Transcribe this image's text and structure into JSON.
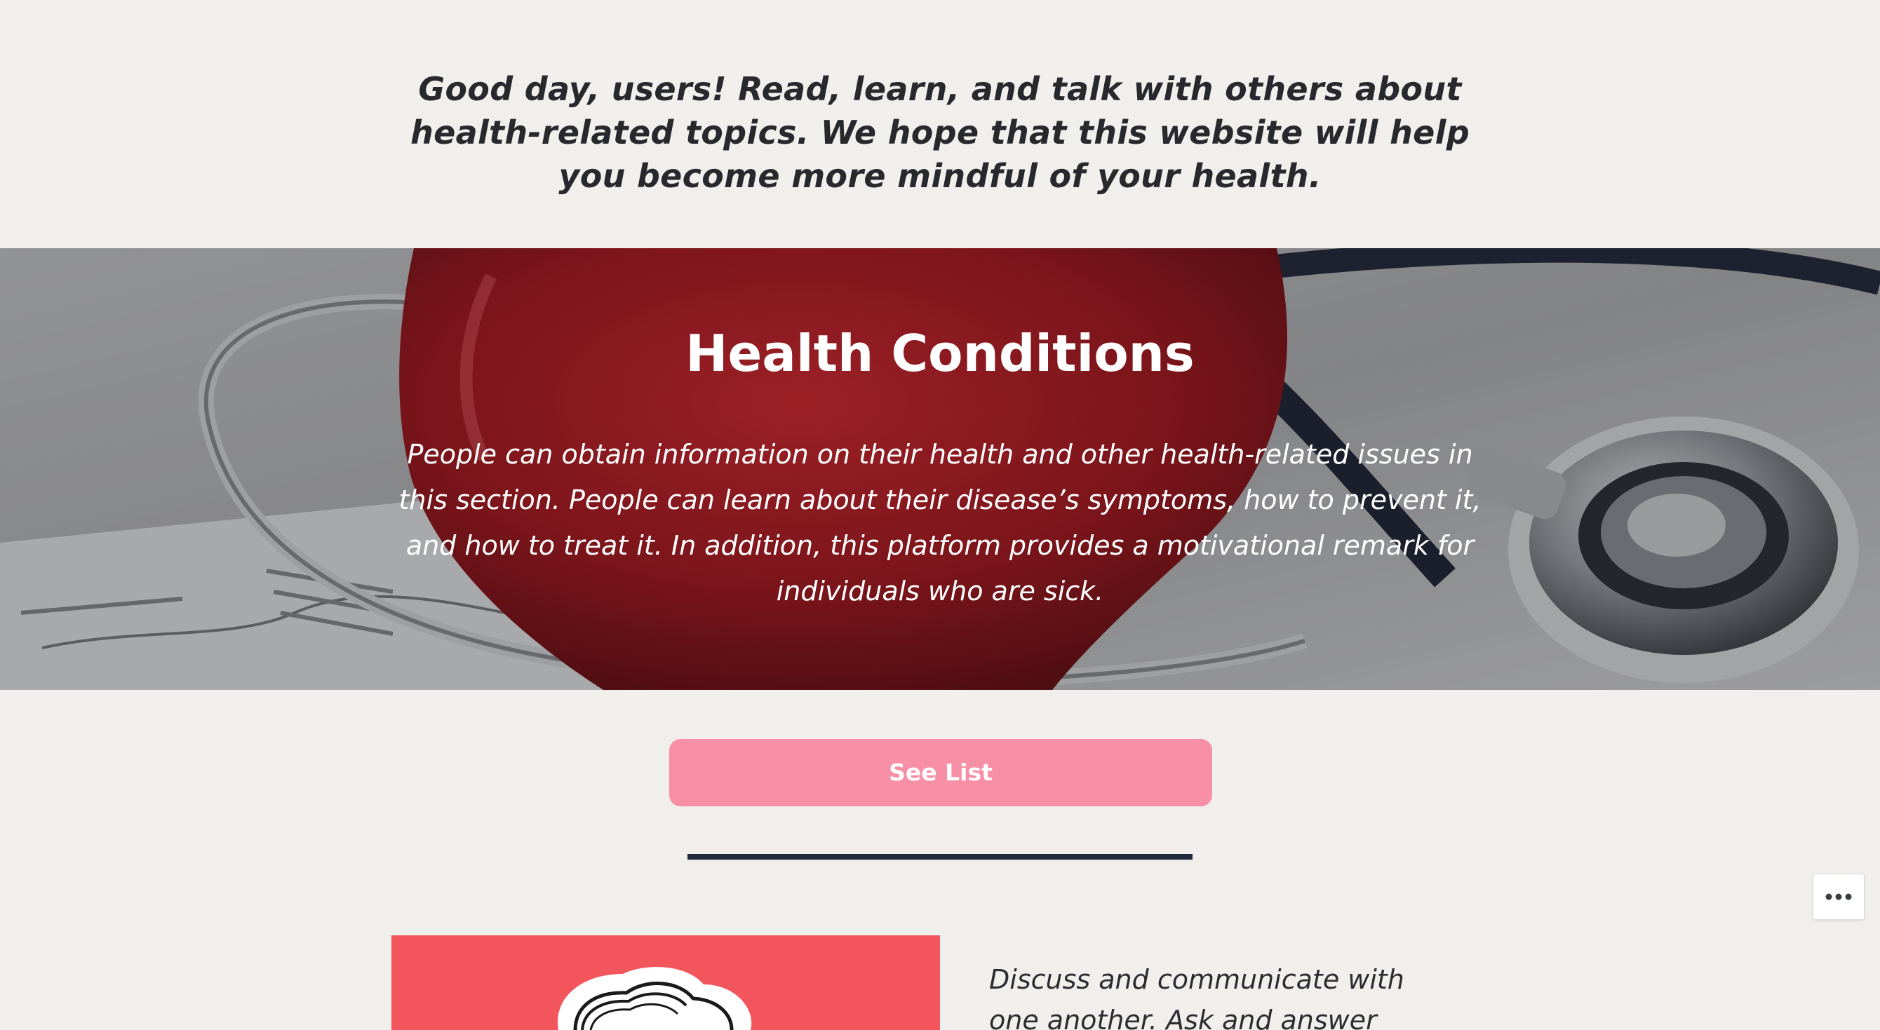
{
  "intro": {
    "text": "Good day, users! Read, learn, and talk with others about health-related topics. We hope that this website will help you become more mindful of your health."
  },
  "cover": {
    "title": "Health Conditions",
    "text": "People can obtain information on their health and other health-related issues in this section. People can learn about their disease’s symptoms, how to prevent it, and how to treat it. In addition, this platform provides a motivational remark for individuals who are sick."
  },
  "button": {
    "label": "See List"
  },
  "feature": {
    "text": "Discuss and communicate with one another. Ask and answer"
  },
  "colors": {
    "background": "#f0efeb",
    "button": "#f78fa7",
    "separator": "#1f2a3c",
    "heart_red": "#a8161d",
    "feature_bg": "#f2555c"
  },
  "icons": {
    "more": "ellipsis-icon"
  }
}
